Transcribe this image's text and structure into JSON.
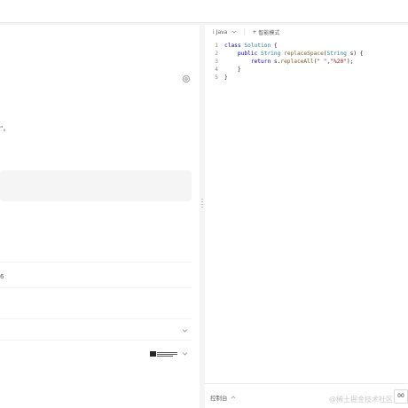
{
  "left": {
    "fragments": [
      "“。",
      "6"
    ]
  },
  "editor": {
    "language": "Java",
    "mode": "智能模式",
    "lines": [
      {
        "no": "1",
        "tokens": [
          {
            "t": "class",
            "c": "kw"
          },
          {
            "t": " ",
            "c": "pl"
          },
          {
            "t": "Solution",
            "c": "cls"
          },
          {
            "t": " {",
            "c": "pl"
          }
        ]
      },
      {
        "no": "2",
        "tokens": [
          {
            "t": "    ",
            "c": "pl"
          },
          {
            "t": "public",
            "c": "kw"
          },
          {
            "t": " ",
            "c": "pl"
          },
          {
            "t": "String",
            "c": "cls"
          },
          {
            "t": " ",
            "c": "pl"
          },
          {
            "t": "replaceSpace",
            "c": "fn"
          },
          {
            "t": "(",
            "c": "pl"
          },
          {
            "t": "String",
            "c": "cls"
          },
          {
            "t": " s) {",
            "c": "pl"
          }
        ]
      },
      {
        "no": "3",
        "tokens": [
          {
            "t": "        ",
            "c": "pl"
          },
          {
            "t": "return",
            "c": "kw"
          },
          {
            "t": " s.",
            "c": "pl"
          },
          {
            "t": "replaceAll",
            "c": "fn"
          },
          {
            "t": "(",
            "c": "pl"
          },
          {
            "t": "\" \"",
            "c": "str"
          },
          {
            "t": ",",
            "c": "pl"
          },
          {
            "t": "\"%20\"",
            "c": "str"
          },
          {
            "t": ");",
            "c": "pl"
          }
        ]
      },
      {
        "no": "4",
        "tokens": [
          {
            "t": "    }",
            "c": "pl"
          }
        ]
      },
      {
        "no": "5",
        "tokens": [
          {
            "t": "}",
            "c": "pl"
          }
        ]
      }
    ]
  },
  "bottom": {
    "console_label": "控制台",
    "watermark": "@稀土掘金技术社区",
    "run_label": "00"
  },
  "icons": {
    "gear": "gear-icon",
    "chevron": "chevron-down-icon",
    "language": "language-icon",
    "mode": "plus-icon",
    "console_toggle": "chevron-up-icon",
    "logo": "logo-icon"
  }
}
